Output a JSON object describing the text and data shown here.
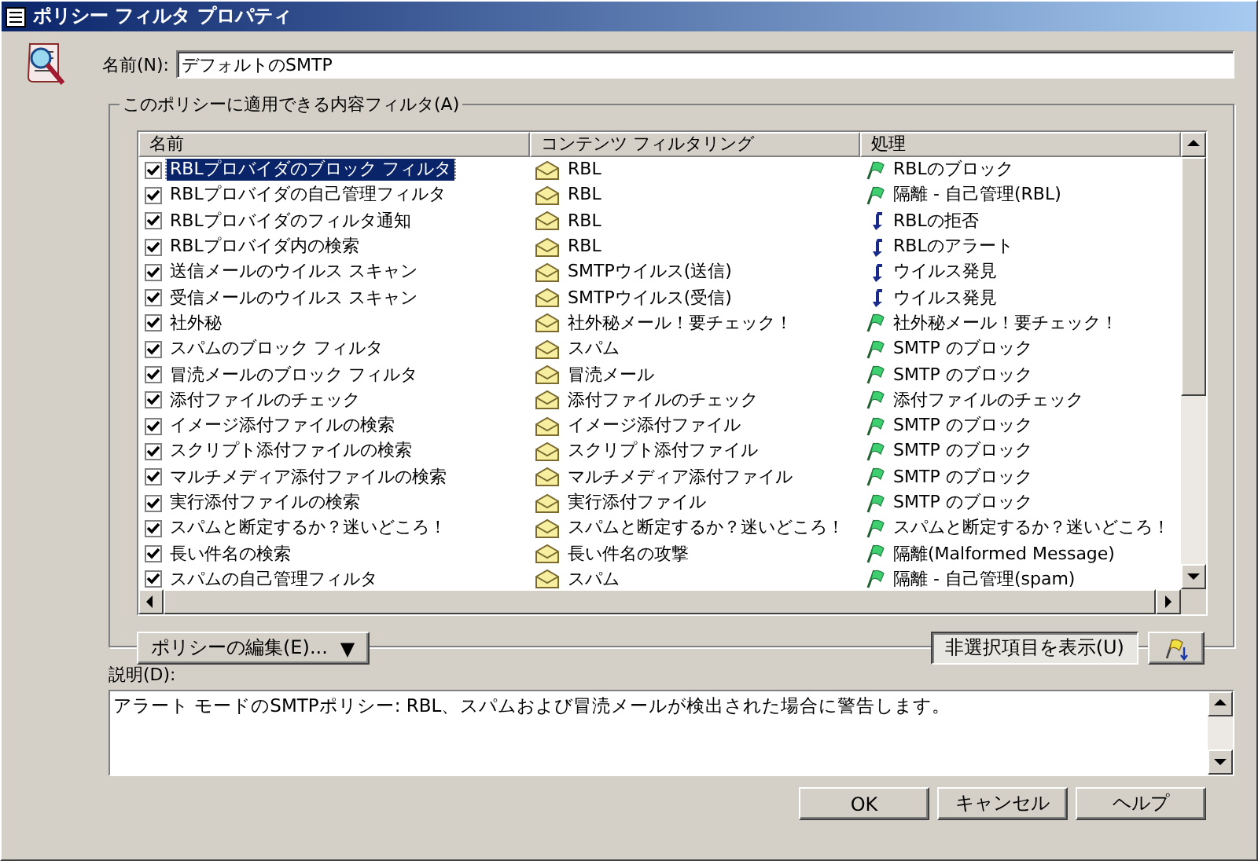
{
  "window": {
    "title": "ポリシー フィルタ プロパティ"
  },
  "name_field": {
    "label": "名前(N):",
    "value": "デフォルトのSMTP"
  },
  "filters_group": {
    "title": "このポリシーに適用できる内容フィルタ(A)",
    "table": {
      "columns": [
        "名前",
        "コンテンツ フィルタリング",
        "処理"
      ],
      "rows": [
        {
          "checked": true,
          "selected": true,
          "name": "RBLプロバイダのブロック フィルタ",
          "content": "RBL",
          "kind": "flag",
          "action": "RBLのブロック"
        },
        {
          "checked": true,
          "selected": false,
          "name": "RBLプロバイダの自己管理フィルタ",
          "content": "RBL",
          "kind": "flag",
          "action": "隔離 - 自己管理(RBL)"
        },
        {
          "checked": true,
          "selected": false,
          "name": "RBLプロバイダのフィルタ通知",
          "content": "RBL",
          "kind": "arrow",
          "action": "RBLの拒否"
        },
        {
          "checked": true,
          "selected": false,
          "name": "RBLプロバイダ内の検索",
          "content": "RBL",
          "kind": "arrow",
          "action": "RBLのアラート"
        },
        {
          "checked": true,
          "selected": false,
          "name": "送信メールのウイルス スキャン",
          "content": "SMTPウイルス(送信)",
          "kind": "arrow",
          "action": "ウイルス発見"
        },
        {
          "checked": true,
          "selected": false,
          "name": "受信メールのウイルス スキャン",
          "content": "SMTPウイルス(受信)",
          "kind": "arrow",
          "action": "ウイルス発見"
        },
        {
          "checked": true,
          "selected": false,
          "name": "社外秘",
          "content": "社外秘メール！要チェック！",
          "kind": "flag",
          "action": "社外秘メール！要チェック！"
        },
        {
          "checked": true,
          "selected": false,
          "name": "スパムのブロック フィルタ",
          "content": "スパム",
          "kind": "flag",
          "action": "SMTP のブロック"
        },
        {
          "checked": true,
          "selected": false,
          "name": "冒涜メールのブロック フィルタ",
          "content": "冒涜メール",
          "kind": "flag",
          "action": "SMTP のブロック"
        },
        {
          "checked": true,
          "selected": false,
          "name": "添付ファイルのチェック",
          "content": "添付ファイルのチェック",
          "kind": "flag",
          "action": "添付ファイルのチェック"
        },
        {
          "checked": true,
          "selected": false,
          "name": "イメージ添付ファイルの検索",
          "content": "イメージ添付ファイル",
          "kind": "flag",
          "action": "SMTP のブロック"
        },
        {
          "checked": true,
          "selected": false,
          "name": "スクリプト添付ファイルの検索",
          "content": "スクリプト添付ファイル",
          "kind": "flag",
          "action": "SMTP のブロック"
        },
        {
          "checked": true,
          "selected": false,
          "name": "マルチメディア添付ファイルの検索",
          "content": "マルチメディア添付ファイル",
          "kind": "flag",
          "action": "SMTP のブロック"
        },
        {
          "checked": true,
          "selected": false,
          "name": "実行添付ファイルの検索",
          "content": "実行添付ファイル",
          "kind": "flag",
          "action": "SMTP のブロック"
        },
        {
          "checked": true,
          "selected": false,
          "name": "スパムと断定するか？迷いどころ！",
          "content": "スパムと断定するか？迷いどころ！",
          "kind": "flag",
          "action": "スパムと断定するか？迷いどころ！"
        },
        {
          "checked": true,
          "selected": false,
          "name": "長い件名の検索",
          "content": "長い件名の攻撃",
          "kind": "flag",
          "action": "隔離(Malformed Message)"
        },
        {
          "checked": true,
          "selected": false,
          "name": "スパムの自己管理フィルタ",
          "content": "スパム",
          "kind": "flag",
          "action": "隔離 - 自己管理(spam)"
        }
      ]
    },
    "edit_button": {
      "label": "ポリシーの編集(E)...",
      "caret": "▼"
    },
    "show_unselected_button": {
      "label": "非選択項目を表示(U)",
      "pressed": true
    }
  },
  "description": {
    "label": "説明(D):",
    "text": "アラート モードのSMTPポリシー: RBL、スパムおよび冒涜メールが検出された場合に警告します。"
  },
  "buttons": [
    "OK",
    "キャンセル",
    "ヘルプ"
  ]
}
